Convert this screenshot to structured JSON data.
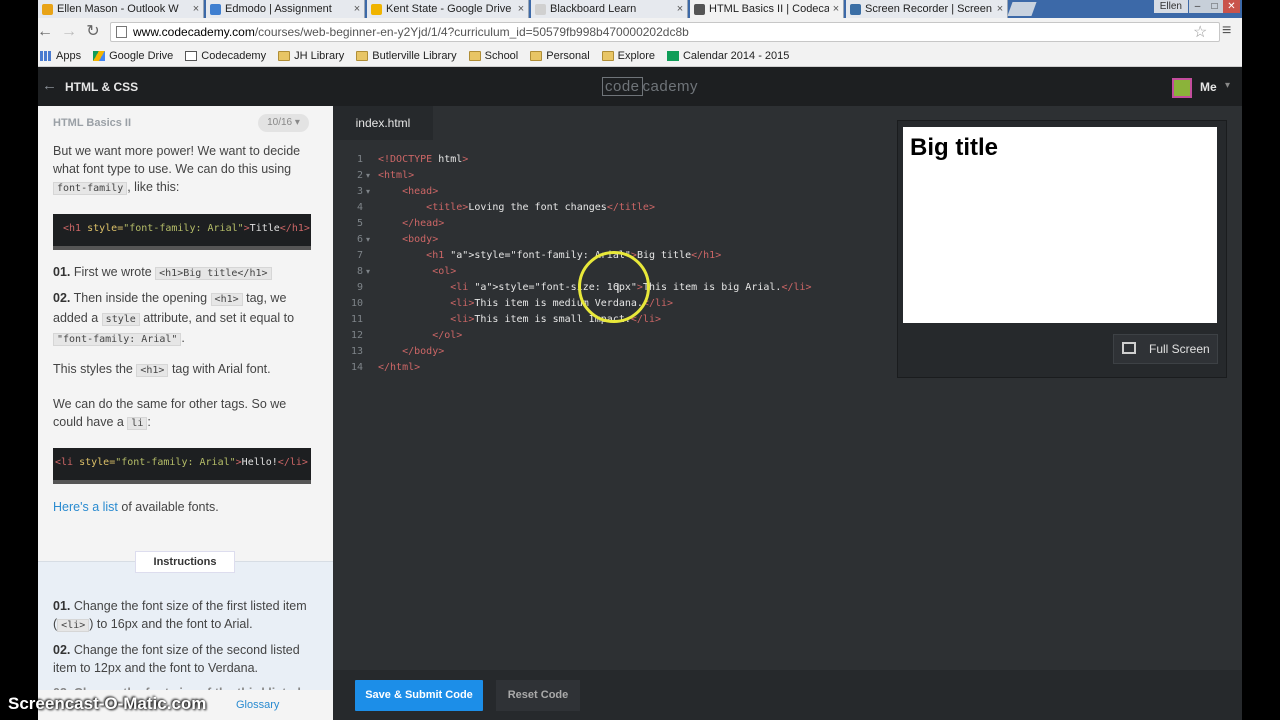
{
  "browser": {
    "tabs": [
      {
        "label": "Ellen Mason - Outlook W",
        "icon": "outlook-icon",
        "color": "#e8a317"
      },
      {
        "label": "Edmodo | Assignment",
        "icon": "edmodo-icon",
        "color": "#3f7fd0"
      },
      {
        "label": "Kent State - Google Drive",
        "icon": "google-drive-icon",
        "color": "#f0b400"
      },
      {
        "label": "Blackboard Learn",
        "icon": "page-icon",
        "color": "#d0d0d0"
      },
      {
        "label": "HTML Basics II | Codecade",
        "icon": "codecademy-icon",
        "color": "#555555"
      },
      {
        "label": "Screen Recorder | Screen",
        "icon": "screencast-icon",
        "color": "#3a6ea5"
      }
    ],
    "user": "Ellen",
    "window_buttons": [
      "–",
      "□",
      "✕"
    ],
    "url_host": "www.codecademy.com",
    "url_path": "/courses/web-beginner-en-y2Yjd/1/4?curriculum_id=50579fb998b470000202dc8b",
    "bookmarks": [
      {
        "label": "Apps",
        "icon": "apps-icon"
      },
      {
        "label": "Google Drive",
        "icon": "google-drive-icon"
      },
      {
        "label": "Codecademy",
        "icon": "codecademy-icon"
      },
      {
        "label": "JH Library",
        "icon": "folder-icon"
      },
      {
        "label": "Butlerville Library",
        "icon": "folder-icon"
      },
      {
        "label": "School",
        "icon": "folder-icon"
      },
      {
        "label": "Personal",
        "icon": "folder-icon"
      },
      {
        "label": "Explore",
        "icon": "folder-icon"
      },
      {
        "label": "Calendar 2014 - 2015",
        "icon": "sheets-icon"
      }
    ]
  },
  "header": {
    "course": "HTML & CSS",
    "logo_a": "code",
    "logo_b": "cademy",
    "user": "Me"
  },
  "lesson": {
    "title": "HTML Basics II",
    "progress": "10/16 ▾",
    "p1_a": "But we want more power! We want to decide what font type to use. We can do this using ",
    "p1_code": "font-family",
    "p1_b": ", like this:",
    "example1": {
      "open": "<h1 ",
      "attr": "style=",
      "val": "\"font-family: Arial\"",
      "close": ">",
      "text": "Title",
      "end": "</h1>"
    },
    "s1_num": "01.",
    "s1_a": " First we wrote ",
    "s1_code": "<h1>Big title</h1>",
    "s2_num": "02.",
    "s2_a": " Then inside the opening ",
    "s2_code1": "<h1>",
    "s2_b": " tag, we added a ",
    "s2_code2": "style",
    "s2_c": " attribute, and set it equal to ",
    "s2_code3": "\"font-family: Arial\"",
    "s2_d": ".",
    "p2_a": "This styles the ",
    "p2_code": "<h1>",
    "p2_b": " tag with Arial font.",
    "p3_a": "We can do the same for other tags. So we could have a ",
    "p3_code": "li",
    "p3_b": ":",
    "example2": {
      "open": "<li ",
      "attr": "style=",
      "val": "\"font-family: Arial\"",
      "close": ">",
      "text": "Hello!",
      "end": "</li>"
    },
    "link_text": "Here's a list",
    "link_after": " of available fonts.",
    "instructions_label": "Instructions",
    "i1_num": "01.",
    "i1_a": " Change the font size of the first listed item (",
    "i1_code": "<li>",
    "i1_b": ") to 16px and the font to Arial.",
    "i2_num": "02.",
    "i2_a": " Change the font size of the second listed item to 12px and the font to Verdana.",
    "i3_a": "03. Change the font size of the third listed",
    "glossary": "Glossary"
  },
  "editor": {
    "filename": "index.html",
    "lines": [
      "<!DOCTYPE html>",
      "<html>",
      "    <head>",
      "        <title>Loving the font changes</title>",
      "    </head>",
      "    <body>",
      "        <h1 style=\"font-family: Arial\">Big title</h1>",
      "         <ol>",
      "            <li style=\"font-size: 16px\">This item is big Arial.</li>",
      "            <li>This item is medium Verdana.</li>",
      "            <li>This item is small Impact.</li>",
      "         </ol>",
      "    </body>",
      "</html>"
    ],
    "line_numbers": [
      "1",
      "2",
      "3",
      "4",
      "5",
      "6",
      "7",
      "8",
      "9",
      "10",
      "11",
      "12",
      "13",
      "14"
    ]
  },
  "preview": {
    "heading": "Big title",
    "fullscreen_label": "Full Screen"
  },
  "actions": {
    "submit": "Save & Submit Code",
    "reset": "Reset Code"
  },
  "watermark": "Screencast-O-Matic.com"
}
